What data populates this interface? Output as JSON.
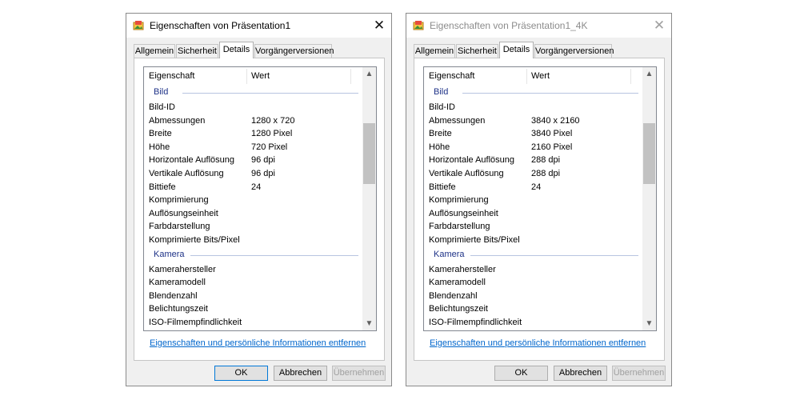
{
  "dialogs": [
    {
      "title": "Eigenschaften von Präsentation1",
      "tabs": [
        "Allgemein",
        "Sicherheit",
        "Details",
        "Vorgängerversionen"
      ],
      "active_tab": "Details",
      "columns": [
        "Eigenschaft",
        "Wert"
      ],
      "group_bild": "Bild",
      "bild_rows": [
        {
          "k": "Bild-ID",
          "v": ""
        },
        {
          "k": "Abmessungen",
          "v": "1280 x 720"
        },
        {
          "k": "Breite",
          "v": "1280 Pixel"
        },
        {
          "k": "Höhe",
          "v": "720 Pixel"
        },
        {
          "k": "Horizontale Auflösung",
          "v": "96 dpi"
        },
        {
          "k": "Vertikale Auflösung",
          "v": "96 dpi"
        },
        {
          "k": "Bittiefe",
          "v": "24"
        },
        {
          "k": "Komprimierung",
          "v": ""
        },
        {
          "k": "Auflösungseinheit",
          "v": ""
        },
        {
          "k": "Farbdarstellung",
          "v": ""
        },
        {
          "k": "Komprimierte Bits/Pixel",
          "v": ""
        }
      ],
      "group_kamera": "Kamera",
      "kamera_rows": [
        {
          "k": "Kamerahersteller",
          "v": ""
        },
        {
          "k": "Kameramodell",
          "v": ""
        },
        {
          "k": "Blendenzahl",
          "v": ""
        },
        {
          "k": "Belichtungszeit",
          "v": ""
        },
        {
          "k": "ISO-Filmempfindlichkeit",
          "v": ""
        }
      ],
      "link": "Eigenschaften und persönliche Informationen entfernen",
      "ok": "OK",
      "cancel": "Abbrechen",
      "apply": "Übernehmen"
    },
    {
      "title": "Eigenschaften von Präsentation1_4K",
      "tabs": [
        "Allgemein",
        "Sicherheit",
        "Details",
        "Vorgängerversionen"
      ],
      "active_tab": "Details",
      "columns": [
        "Eigenschaft",
        "Wert"
      ],
      "group_bild": "Bild",
      "bild_rows": [
        {
          "k": "Bild-ID",
          "v": ""
        },
        {
          "k": "Abmessungen",
          "v": "3840 x 2160"
        },
        {
          "k": "Breite",
          "v": "3840 Pixel"
        },
        {
          "k": "Höhe",
          "v": "2160 Pixel"
        },
        {
          "k": "Horizontale Auflösung",
          "v": "288 dpi"
        },
        {
          "k": "Vertikale Auflösung",
          "v": "288 dpi"
        },
        {
          "k": "Bittiefe",
          "v": "24"
        },
        {
          "k": "Komprimierung",
          "v": ""
        },
        {
          "k": "Auflösungseinheit",
          "v": ""
        },
        {
          "k": "Farbdarstellung",
          "v": ""
        },
        {
          "k": "Komprimierte Bits/Pixel",
          "v": ""
        }
      ],
      "group_kamera": "Kamera",
      "kamera_rows": [
        {
          "k": "Kamerahersteller",
          "v": ""
        },
        {
          "k": "Kameramodell",
          "v": ""
        },
        {
          "k": "Blendenzahl",
          "v": ""
        },
        {
          "k": "Belichtungszeit",
          "v": ""
        },
        {
          "k": "ISO-Filmempfindlichkeit",
          "v": ""
        }
      ],
      "link": "Eigenschaften und persönliche Informationen entfernen",
      "ok": "OK",
      "cancel": "Abbrechen",
      "apply": "Übernehmen"
    }
  ],
  "icons": {
    "app": "image-file-icon",
    "close": "close-icon",
    "scroll_up": "chevron-up-icon",
    "scroll_down": "chevron-down-icon"
  }
}
